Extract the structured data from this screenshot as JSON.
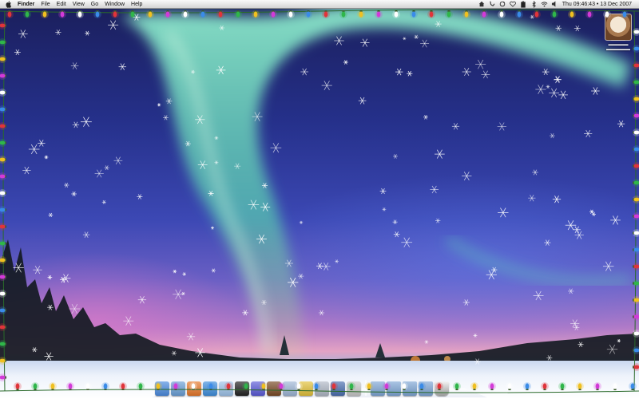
{
  "menubar": {
    "apple_icon": "apple-icon",
    "app_name": "Finder",
    "items": [
      "File",
      "Edit",
      "View",
      "Go",
      "Window",
      "Help"
    ],
    "status_icons": [
      "home-icon",
      "script-icon",
      "sync-icon",
      "heart-icon",
      "battery-icon",
      "bluetooth-icon",
      "wifi-icon",
      "volume-icon"
    ],
    "clock": "Thu 09:46:43 • 13 Dec 2007"
  },
  "desktop": {
    "item_icon": "hard-drive-image-icon",
    "wallpaper": "aurora-borealis-snow-scene"
  },
  "dock": {
    "apps": [
      {
        "name": "finder",
        "icon": "finder-icon",
        "color": "#4a8be0"
      },
      {
        "name": "preview",
        "icon": "preview-icon",
        "color": "#6aa0d8"
      },
      {
        "name": "firefox",
        "icon": "firefox-icon",
        "color": "#e8782a"
      },
      {
        "name": "safari",
        "icon": "safari-icon",
        "color": "#3f8fde"
      },
      {
        "name": "itunes",
        "icon": "itunes-icon",
        "color": "#9ec3ea"
      },
      {
        "name": "terminal",
        "icon": "terminal-icon",
        "color": "#222222"
      },
      {
        "name": "camino",
        "icon": "camino-icon",
        "color": "#5a5ad8"
      },
      {
        "name": "squirrel",
        "icon": "squirrel-icon",
        "color": "#7a4a25"
      },
      {
        "name": "mail",
        "icon": "mail-icon",
        "color": "#9eb6d6"
      },
      {
        "name": "neooffice",
        "icon": "neooffice-icon",
        "color": "#e3c13a"
      },
      {
        "name": "photo",
        "icon": "photo-icon",
        "color": "#b0b8c6"
      },
      {
        "name": "sap",
        "icon": "sap-icon",
        "color": "#4b6fb0"
      },
      {
        "name": "disk-utility",
        "icon": "disk-utility-icon",
        "color": "#c9c9c9"
      }
    ],
    "folders": [
      {
        "name": "applications",
        "icon": "folder-icon",
        "color": "#7fa7d6"
      },
      {
        "name": "documents",
        "icon": "folder-icon",
        "color": "#7fa7d6"
      },
      {
        "name": "downloads",
        "icon": "folder-icon",
        "color": "#7fa7d6"
      },
      {
        "name": "stack",
        "icon": "folder-icon",
        "color": "#7fa7d6"
      }
    ],
    "trash_icon": "trash-icon"
  },
  "theme": {
    "menubar_bg": "#e6e6e6",
    "light_colors": [
      "#e0343a",
      "#2fb64a",
      "#f0c020",
      "#d33ad8",
      "#ffffff",
      "#3a8be8"
    ]
  }
}
